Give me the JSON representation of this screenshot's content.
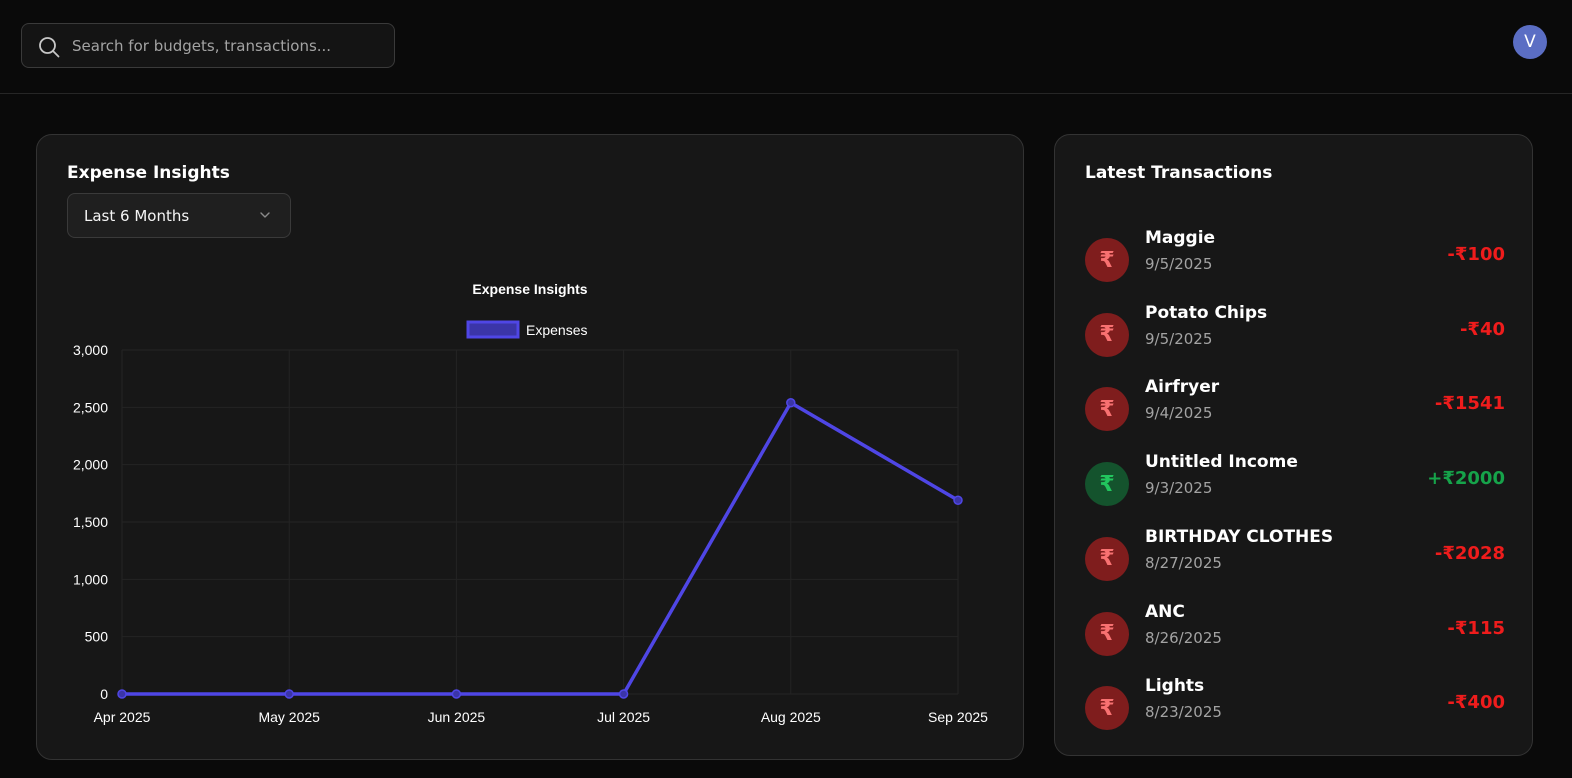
{
  "search": {
    "placeholder": "Search for budgets, transactions..."
  },
  "user": {
    "avatar_initial": "V"
  },
  "insights": {
    "title": "Expense Insights",
    "range_selected": "Last 6 Months"
  },
  "chart_data": {
    "type": "line",
    "title": "Expense Insights",
    "x": [
      "Apr 2025",
      "May 2025",
      "Jun 2025",
      "Jul 2025",
      "Aug 2025",
      "Sep 2025"
    ],
    "series": [
      {
        "name": "Expenses",
        "values": [
          0,
          0,
          0,
          0,
          2540,
          1690
        ],
        "color": "#4f46e5"
      }
    ],
    "ylim": [
      0,
      3000
    ],
    "yticks": [
      "0",
      "500",
      "1,000",
      "1,500",
      "2,000",
      "2,500",
      "3,000"
    ],
    "grid": true,
    "legend": "top-center"
  },
  "transactions": {
    "title": "Latest Transactions",
    "items": [
      {
        "name": "Maggie",
        "date": "9/5/2025",
        "amount": "-₹100",
        "type": "expense",
        "icon": "₹"
      },
      {
        "name": "Potato Chips",
        "date": "9/5/2025",
        "amount": "-₹40",
        "type": "expense",
        "icon": "₹"
      },
      {
        "name": "Airfryer",
        "date": "9/4/2025",
        "amount": "-₹1541",
        "type": "expense",
        "icon": "₹"
      },
      {
        "name": "Untitled Income",
        "date": "9/3/2025",
        "amount": "+₹2000",
        "type": "income",
        "icon": "₹"
      },
      {
        "name": "BIRTHDAY CLOTHES",
        "date": "8/27/2025",
        "amount": "-₹2028",
        "type": "expense",
        "icon": "₹"
      },
      {
        "name": "ANC",
        "date": "8/26/2025",
        "amount": "-₹115",
        "type": "expense",
        "icon": "₹"
      },
      {
        "name": "Lights",
        "date": "8/23/2025",
        "amount": "-₹400",
        "type": "expense",
        "icon": "₹"
      }
    ]
  }
}
